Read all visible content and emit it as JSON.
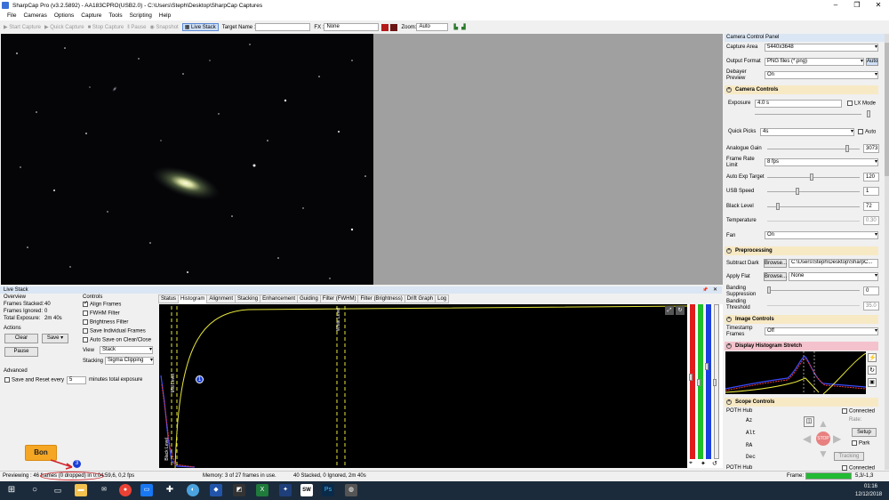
{
  "window": {
    "title": "SharpCap Pro (v3.2.5892) - AA183CPRO(USB2.0) - C:\\Users\\Steph\\Desktop\\SharpCap Captures",
    "minimize": "–",
    "maximize": "❐",
    "close": "✕"
  },
  "menu": [
    "File",
    "Cameras",
    "Options",
    "Capture",
    "Tools",
    "Scripting",
    "Help"
  ],
  "toolbar": {
    "start_capture": "Start Capture",
    "quick_capture": "Quick Capture",
    "stop_capture": "Stop Capture",
    "pause": "Pause",
    "snapshot": "Snapshot",
    "live_stack": "Live Stack",
    "target_name_label": "Target Name :",
    "target_name_value": "",
    "fx_label": "FX :",
    "fx_value": "None",
    "zoom_label": "Zoom:",
    "zoom_value": "Auto"
  },
  "live_stack": {
    "header": "Live Stack",
    "pin": "📌",
    "close": "✕",
    "overview_label": "Overview",
    "frames_stacked_label": "Frames Stacked:",
    "frames_stacked": "40",
    "frames_ignored_label": "Frames Ignored:",
    "frames_ignored": "0",
    "total_exposure_label": "Total Exposure:",
    "total_exposure": "2m 40s",
    "actions_label": "Actions",
    "clear": "Clear",
    "save": "Save",
    "pause": "Pause",
    "advanced_label": "Advanced",
    "save_reset_label": "Save and Reset every",
    "save_reset_value": "5",
    "save_reset_suffix": "minutes total exposure",
    "controls_label": "Controls",
    "align_frames": "Align Frames",
    "fwhm_filter": "FWHM Filter",
    "brightness_filter": "Brightness Filter",
    "save_individual": "Save Individual Frames",
    "auto_save": "Auto Save on Clear/Close",
    "view_label": "View",
    "view_value": "Stack",
    "stacking_label": "Stacking",
    "stacking_value": "Sigma Clipping"
  },
  "tabs": [
    "Status",
    "Histogram",
    "Alignment",
    "Stacking",
    "Enhancement",
    "Guiding",
    "Filter (FWHM)",
    "Filter (Brightness)",
    "Drift Graph",
    "Log"
  ],
  "active_tab": "Histogram",
  "histogram": {
    "mid_level_label": "Mid Level",
    "white_level_label": "White Level",
    "black_level_label": "Black Level",
    "marker_1": "1",
    "marker_2": "2"
  },
  "right_panel": {
    "title": "Camera Control Panel",
    "capture_area_label": "Capture Area",
    "capture_area": "5440x3648",
    "output_format_label": "Output Format",
    "output_format": "PNG files (*.png)",
    "output_format_auto": "Auto",
    "debayer_label": "Debayer Preview",
    "debayer": "On",
    "camera_controls": "Camera Controls",
    "exposure_label": "Exposure",
    "exposure": "4.0 s",
    "lx_mode": "LX Mode",
    "quick_picks_label": "Quick Picks",
    "quick_picks": "4s",
    "auto": "Auto",
    "gain_label": "Analogue Gain",
    "gain": "3073",
    "frame_rate_label": "Frame Rate Limit",
    "frame_rate": "8 fps",
    "auto_exp_label": "Auto Exp Target",
    "auto_exp": "120",
    "usb_speed_label": "USB Speed",
    "usb_speed": "1",
    "black_level_label": "Black Level",
    "black_level": "72",
    "temperature_label": "Temperature",
    "temperature": "0.30",
    "fan_label": "Fan",
    "fan": "On",
    "preprocessing": "Preprocessing",
    "subtract_dark_label": "Subtract Dark",
    "browse": "Browse...",
    "subtract_dark": "C:\\Users\\Steph\\Desktop\\SharpC...",
    "apply_flat_label": "Apply Flat",
    "apply_flat": "None",
    "banding_suppression_label": "Banding Suppression",
    "banding_suppression": "0",
    "banding_threshold_label": "Banding Threshold",
    "banding_threshold": "35.0",
    "image_controls": "Image Controls",
    "timestamp_label": "Timestamp Frames",
    "timestamp": "Off",
    "display_histogram": "Display Histogram Stretch",
    "scope_controls": "Scope Controls",
    "poth_hub": "POTH Hub",
    "connected": "Connected",
    "rate_label": "Rate:",
    "az_label": "Az",
    "alt_label": "Alt",
    "ra_label": "RA",
    "dec_label": "Dec",
    "setup": "Setup",
    "park": "Park",
    "tracking": "Tracking",
    "stop": "STOP",
    "poth_hub2": "POTH Hub",
    "connected2": "Connected"
  },
  "status": {
    "previewing": "Previewing : 46 frames (0 dropped) in 0:04:59,6, 0,2 fps",
    "memory": "Memory: 3 of 27 frames in use.",
    "stack_info": "40 Stacked, 0 Ignored, 2m 40s",
    "frame_label": "Frame:",
    "frame_value": "5,3/-1,3",
    "frame_progress": 1.0
  },
  "annotation": {
    "label": "Bon",
    "marker_3": "3"
  },
  "taskbar": {
    "time": "01:16",
    "date": "12/12/2018"
  },
  "colors": {
    "accent_green": "#22bb33",
    "title_bg": "#ffffff",
    "section_header": "#f7e9c4",
    "histogram_section": "#f4c2cc",
    "annotation_orange": "#f5a623",
    "annotation_blue": "#1a3fd6"
  }
}
